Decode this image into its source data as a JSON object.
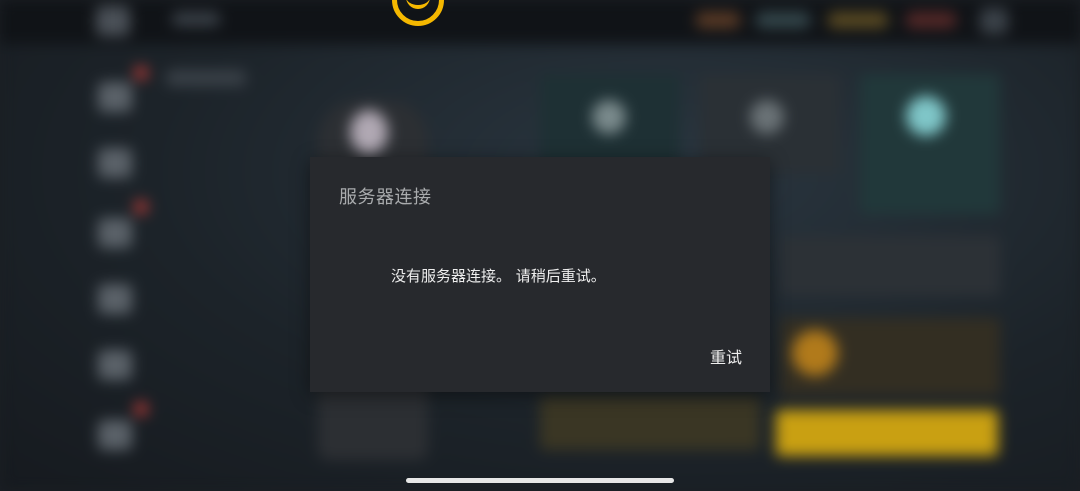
{
  "dialog": {
    "title": "服务器连接",
    "message": "没有服务器连接。 请稍后重试。",
    "retry_label": "重试"
  },
  "colors": {
    "accent": "#f5b800",
    "dialog_background": "#27292d"
  },
  "icons": {
    "logo": "game-logo-icon"
  }
}
